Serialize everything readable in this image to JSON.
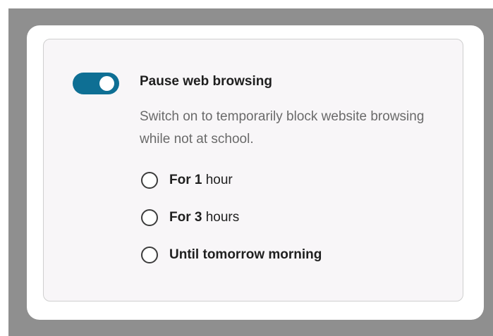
{
  "setting": {
    "toggle_on": true,
    "title": "Pause web browsing",
    "description": "Switch on to temporarily block website browsing while not at school."
  },
  "options": [
    {
      "label": "For 1 hour"
    },
    {
      "label": "For 3 hours"
    },
    {
      "label": "Until tomorrow morning"
    }
  ],
  "colors": {
    "accent": "#0e6f94",
    "backdrop": "#8f8f8f",
    "panel": "#f8f6f8"
  }
}
